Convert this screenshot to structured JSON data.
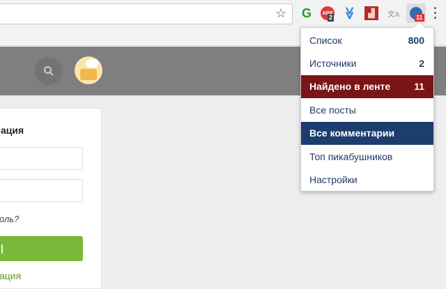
{
  "toolbar": {
    "extensions": [
      {
        "name": "grammarly",
        "glyph": "G",
        "color": "#1a9c2b"
      },
      {
        "name": "adblock",
        "glyph": "ABP",
        "color": "#e03a3a",
        "badge": "2"
      },
      {
        "name": "pocket-like",
        "glyph": "≫",
        "color": "#3b82d6"
      },
      {
        "name": "chart-ext",
        "glyph": "▟",
        "color": "#b22a2a"
      },
      {
        "name": "translate",
        "glyph": "文A",
        "color": "#aaa"
      },
      {
        "name": "pikabu-ext",
        "glyph": "●",
        "color": "#2c6fb0",
        "badge": "11"
      }
    ]
  },
  "login": {
    "title": "ация",
    "forgot": "оль?",
    "register": "ация"
  },
  "menu": {
    "items": [
      {
        "label": "Список",
        "count": "800"
      },
      {
        "label": "Источники",
        "count": "2"
      },
      {
        "label": "Найдено в ленте",
        "count": "11"
      },
      {
        "label": "Все посты",
        "count": ""
      },
      {
        "label": "Все комментарии",
        "count": ""
      },
      {
        "label": "Топ пикабушников",
        "count": ""
      },
      {
        "label": "Настройки",
        "count": ""
      }
    ]
  },
  "colors": {
    "highlight_red": "#7b1416",
    "highlight_blue": "#1d3d6e",
    "green": "#79b83a"
  }
}
